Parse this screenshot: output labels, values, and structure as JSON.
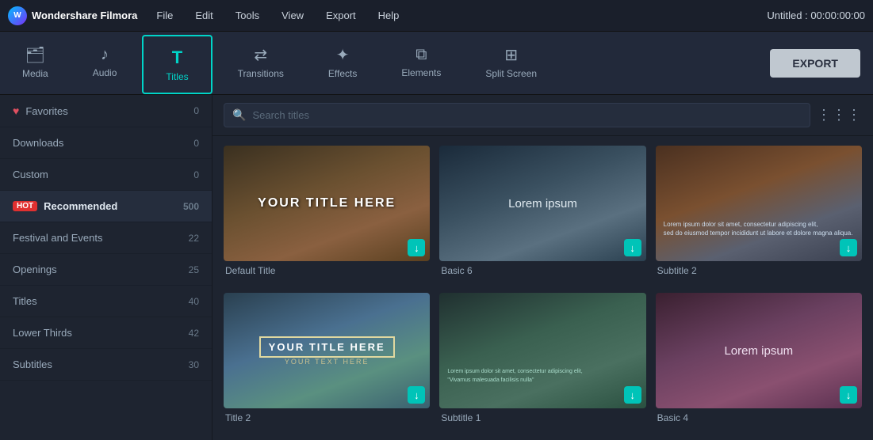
{
  "menuBar": {
    "appName": "Wondershare Filmora",
    "menus": [
      "File",
      "Edit",
      "Tools",
      "View",
      "Export",
      "Help"
    ],
    "titleTime": "Untitled : 00:00:00:00"
  },
  "toolbar": {
    "items": [
      {
        "id": "media",
        "label": "Media",
        "icon": "🗂"
      },
      {
        "id": "audio",
        "label": "Audio",
        "icon": "♪"
      },
      {
        "id": "titles",
        "label": "Titles",
        "icon": "T",
        "active": true
      },
      {
        "id": "transitions",
        "label": "Transitions",
        "icon": "↔"
      },
      {
        "id": "effects",
        "label": "Effects",
        "icon": "✦"
      },
      {
        "id": "elements",
        "label": "Elements",
        "icon": "⧉"
      },
      {
        "id": "splitscreen",
        "label": "Split Screen",
        "icon": "⊞"
      }
    ],
    "exportLabel": "EXPORT"
  },
  "sidebar": {
    "items": [
      {
        "id": "favorites",
        "label": "Favorites",
        "count": "0",
        "heart": true
      },
      {
        "id": "downloads",
        "label": "Downloads",
        "count": "0"
      },
      {
        "id": "custom",
        "label": "Custom",
        "count": "0"
      },
      {
        "id": "recommended",
        "label": "Recommended",
        "count": "500",
        "hot": true,
        "active": true
      },
      {
        "id": "festival",
        "label": "Festival and Events",
        "count": "22"
      },
      {
        "id": "openings",
        "label": "Openings",
        "count": "25"
      },
      {
        "id": "titles",
        "label": "Titles",
        "count": "40"
      },
      {
        "id": "lowerthirds",
        "label": "Lower Thirds",
        "count": "42"
      },
      {
        "id": "subtitles",
        "label": "Subtitles",
        "count": "30"
      }
    ]
  },
  "searchBar": {
    "placeholder": "Search titles"
  },
  "thumbnails": [
    {
      "id": "default-title",
      "label": "Default Title",
      "mainText": "YOUR TITLE HERE",
      "type": "title",
      "bg": "vineyard"
    },
    {
      "id": "basic-6",
      "label": "Basic 6",
      "mainText": "Lorem ipsum",
      "type": "subtitle",
      "bg": "mountain"
    },
    {
      "id": "subtitle-2",
      "label": "Subtitle 2",
      "mainText": "",
      "type": "text-block",
      "bg": "desert"
    },
    {
      "id": "title-2",
      "label": "Title 2",
      "mainText": "YOUR TITLE HERE",
      "subText": "YOUR TEXT HERE",
      "type": "title2",
      "bg": "coastal"
    },
    {
      "id": "subtitle-1",
      "label": "Subtitle 1",
      "mainText": "",
      "type": "subtitle-long",
      "bg": "forest"
    },
    {
      "id": "basic-4",
      "label": "Basic 4",
      "mainText": "Lorem ipsum",
      "type": "subtitle",
      "bg": "sunset"
    }
  ],
  "colors": {
    "accent": "#00d4c8",
    "hot": "#e03030",
    "download": "#00c4b8"
  }
}
